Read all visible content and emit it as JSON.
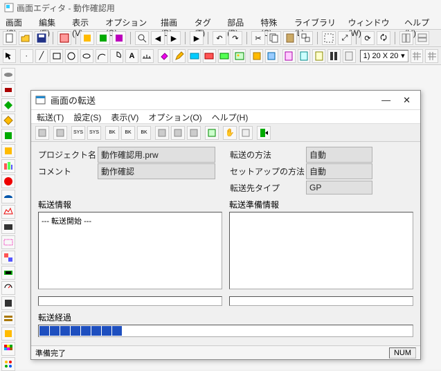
{
  "main": {
    "title": "画面エディタ - 動作確認用",
    "menu": [
      "画面(S)",
      "編集(E)",
      "表示(V)",
      "オプション(O)",
      "描画(D)",
      "タグ(T)",
      "部品(P)",
      "特殊(C)",
      "ライブラリ(L)",
      "ウィンドウ(W)",
      "ヘルプ(H)"
    ],
    "zoom_combo": "1) 20 X 20"
  },
  "dialog": {
    "title": "画面の転送",
    "menu": [
      "転送(T)",
      "設定(S)",
      "表示(V)",
      "オプション(O)",
      "ヘルプ(H)"
    ],
    "fields": {
      "project_label": "プロジェクト名",
      "project_value": "動作確認用.prw",
      "comment_label": "コメント",
      "comment_value": "動作確認",
      "method_label": "転送の方法",
      "method_value": "自動",
      "setup_label": "セットアップの方法",
      "setup_value": "自動",
      "dest_label": "転送先タイプ",
      "dest_value": "GP"
    },
    "transfer_info_label": "転送情報",
    "transfer_info_text": "--- 転送開始 ---",
    "prepare_info_label": "転送準備情報",
    "progress_label": "転送経過",
    "progress_segments_on": 8,
    "progress_segments_total": 34,
    "status_text": "準備完了",
    "status_right": "NUM"
  },
  "icons": {
    "new": "new-icon",
    "open": "open-icon",
    "save": "save-icon"
  }
}
